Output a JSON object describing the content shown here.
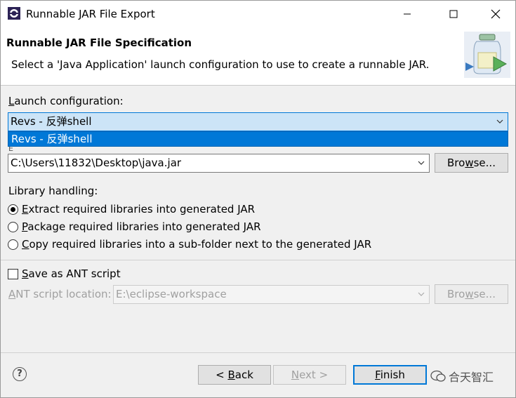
{
  "window": {
    "title": "Runnable JAR File Export"
  },
  "banner": {
    "title": "Runnable JAR File Specification",
    "description": "Select a 'Java Application' launch configuration to use to create a runnable JAR."
  },
  "launch": {
    "label": "Launch configuration:",
    "label_mnemonic": "L",
    "label_rest": "aunch configuration:",
    "selected": "Revs - 反弹shell",
    "options": [
      "Revs - 反弹shell"
    ]
  },
  "export": {
    "label_partial": "E",
    "value": "C:\\Users\\11832\\Desktop\\java.jar",
    "browse_mn": "B",
    "browse_pre": "Bro",
    "browse_u": "w",
    "browse_post": "se..."
  },
  "library": {
    "label": "Library handling:",
    "options": [
      {
        "mn": "E",
        "rest": "xtract required libraries into generated JAR",
        "checked": true
      },
      {
        "mn": "P",
        "rest": "ackage required libraries into generated JAR",
        "checked": false
      },
      {
        "mn": "C",
        "rest": "opy required libraries into a sub-folder next to the generated JAR",
        "checked": false
      }
    ]
  },
  "ant": {
    "save_mn": "S",
    "save_rest": "ave as ANT script",
    "checked": false,
    "location_mn": "A",
    "location_rest": "NT script location:",
    "location_value": "E:\\eclipse-workspace",
    "browse_pre": "Bro",
    "browse_u": "w",
    "browse_post": "se..."
  },
  "footer": {
    "back_pre": "< ",
    "back_mn": "B",
    "back_rest": "ack",
    "next_mn": "N",
    "next_rest": "ext >",
    "finish_mn": "F",
    "finish_rest": "inish",
    "help_glyph": "?"
  },
  "watermark": {
    "text": "合天智汇"
  }
}
